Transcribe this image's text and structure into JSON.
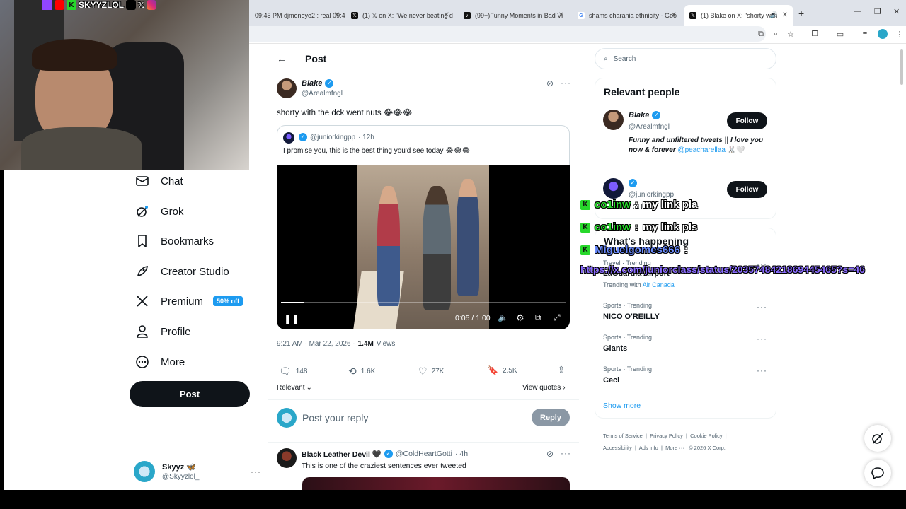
{
  "stream": {
    "channel_name": "SKYYZLOL",
    "social_icons": [
      "twitch-icon",
      "youtube-icon",
      "kick-icon",
      "tiktok-icon",
      "x-icon",
      "instagram-icon"
    ]
  },
  "browser": {
    "tabs": [
      {
        "title": "09:45 PM djmoneye2 : real 09:4",
        "icon": "generic"
      },
      {
        "title": "(1) 𝕏 on X: \"We never beating d",
        "icon": "x"
      },
      {
        "title": "(99+)Funny Moments in Bad Vi",
        "icon": "tiktok"
      },
      {
        "title": "shams charania ethnicity - Goo",
        "icon": "google"
      },
      {
        "title": "(1) Blake on X: \"shorty with",
        "icon": "x",
        "active": true
      }
    ],
    "new_tab_label": "+"
  },
  "sidebar": {
    "items": [
      {
        "label": "Chat",
        "icon": "mail-icon"
      },
      {
        "label": "Grok",
        "icon": "grok-icon"
      },
      {
        "label": "Bookmarks",
        "icon": "bookmark-icon"
      },
      {
        "label": "Creator Studio",
        "icon": "rocket-icon"
      },
      {
        "label": "Premium",
        "icon": "x-logo-icon",
        "badge": "50% off"
      },
      {
        "label": "Profile",
        "icon": "person-icon"
      },
      {
        "label": "More",
        "icon": "more-circle-icon"
      }
    ],
    "post_button": "Post",
    "account": {
      "name": "Skyyz 🦋",
      "handle": "@Skyyzlol_"
    }
  },
  "post": {
    "header_title": "Post",
    "author_name": "Blake",
    "author_handle": "@Arealmfngl",
    "text": "shorty with the dck went nuts 😂😂😂",
    "quote": {
      "handle": "@juniorkingpp",
      "time": "· 12h",
      "text": "I promise you, this is the best thing you'd see today 😂😂😂"
    },
    "video": {
      "time": "0:05 / 1:00",
      "progress": 0.08
    },
    "timestamp": "9:21 AM · Mar 22, 2026 ·",
    "views_count": "1.4M",
    "views_label": "Views",
    "stats": {
      "replies": "148",
      "reposts": "1.6K",
      "likes": "27K",
      "bookmarks": "2.5K"
    },
    "sort_label": "Relevant",
    "view_quotes": "View quotes",
    "reply_placeholder": "Post your reply",
    "reply_button": "Reply"
  },
  "reply_item": {
    "name": "Black Leather Devil 🖤",
    "handle": "@ColdHeartGotti",
    "time": "· 4h",
    "text": "This is one of the craziest sentences ever tweeted"
  },
  "right": {
    "search_placeholder": "Search",
    "relevant_people_title": "Relevant people",
    "people": [
      {
        "name": "Blake",
        "handle": "@Arealmfngl",
        "bio": "Funny and unfiltered tweets || I love you now & forever",
        "bio_link": "@peacharellaa",
        "bio_tail": "🐰🤍",
        "follow": "Follow"
      },
      {
        "name": "",
        "handle": "@juniorkingpp",
        "bio": "I CUSS",
        "follow": "Follow"
      }
    ],
    "happening_title": "What's happening",
    "trends": [
      {
        "category": "Travel · Trending",
        "name": "LaGuardia Airport",
        "sub": "Trending with",
        "sub_link": "Air Canada"
      },
      {
        "category": "Sports · Trending",
        "name": "NICO O'REILLY"
      },
      {
        "category": "Sports · Trending",
        "name": "Giants"
      },
      {
        "category": "Sports · Trending",
        "name": "Ceci"
      }
    ],
    "show_more": "Show more",
    "footer_links": [
      "Terms of Service",
      "Privacy Policy",
      "Cookie Policy",
      "Accessibility",
      "Ads info",
      "More ···",
      "© 2026 X Corp."
    ]
  },
  "chat_overlay": [
    {
      "user": "co1inw",
      "sep": ":",
      "message": "my link pla"
    },
    {
      "user": "co1inw",
      "sep": ":",
      "message": "my link pls"
    },
    {
      "user": "Miguelgomes666",
      "sep": ":",
      "message": "https://x.com/juniorclass/status/2035748421869445465?s=46"
    }
  ],
  "colors": {
    "x_blue": "#1d9bf0",
    "dark": "#0f1419",
    "kick_green": "#27d82b"
  }
}
